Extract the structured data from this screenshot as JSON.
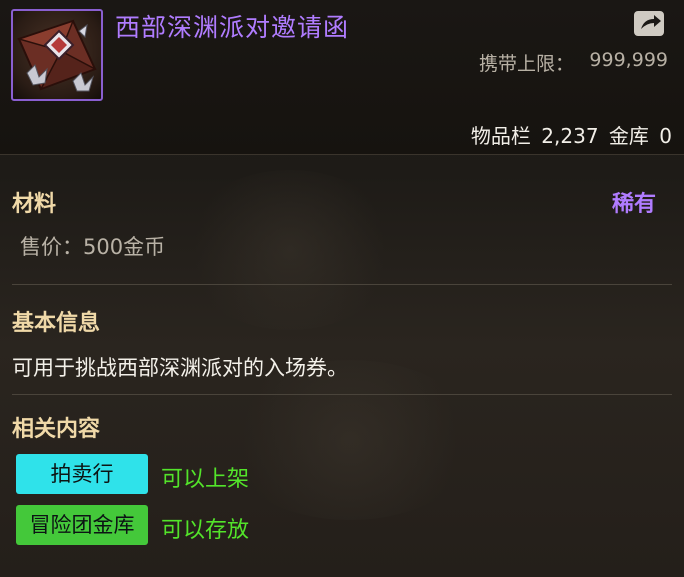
{
  "item": {
    "title": "西部深渊派对邀请函",
    "carry_limit_label": "携带上限：",
    "carry_limit_value": "999,999",
    "inventory_label": "物品栏",
    "inventory_count": "2,237",
    "bank_label": "金库",
    "bank_count": "0",
    "category": "材料",
    "rarity": "稀有",
    "sell_price": "售价：500金币"
  },
  "basic_info": {
    "heading": "基本信息",
    "description": "可用于挑战西部深渊派对的入场券。"
  },
  "related": {
    "heading": "相关内容",
    "entries": [
      {
        "button": "拍卖行",
        "status": "可以上架"
      },
      {
        "button": "冒险团金库",
        "status": "可以存放"
      }
    ]
  },
  "colors": {
    "title": "#b07cff",
    "rarity": "#b07cff",
    "heading": "#f0d9a8",
    "auction_button": "#2fe2ea",
    "bank_button": "#44c83a",
    "status_text": "#53e42a"
  },
  "icons": {
    "item": "invitation-letter-icon",
    "share": "share-export-icon"
  }
}
